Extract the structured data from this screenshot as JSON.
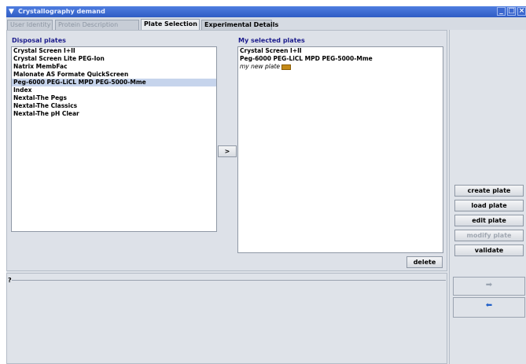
{
  "window": {
    "title": "Crystallography demand",
    "controls": {
      "minimize": "_",
      "maximize": "□",
      "close": "×"
    }
  },
  "tabs": [
    {
      "label": "User Identity",
      "state": "disabled"
    },
    {
      "label": "Protein Description",
      "state": "disabled"
    },
    {
      "label": "Plate Selection",
      "state": "active"
    },
    {
      "label": "Experimental Details",
      "state": "enabled"
    }
  ],
  "disposal": {
    "label": "Disposal plates",
    "items": [
      "Crystal Screen I+II",
      "Crystal Screen Lite PEG-Ion",
      "Natrix MembFac",
      "Malonate AS Formate QuickScreen",
      "Peg-6000 PEG-LiCL MPD PEG-5000-Mme",
      "Index",
      "Nextal-The Pegs",
      "Nextal-The Classics",
      "Nextal-The pH Clear"
    ],
    "selected_item": "Peg-6000 PEG-LiCL MPD PEG-5000-Mme"
  },
  "transfer_button": ">",
  "selected": {
    "label": "My selected plates",
    "items": [
      "Crystal Screen I+II",
      "Peg-6000 PEG-LiCL MPD PEG-5000-Mme",
      "my new plate"
    ]
  },
  "delete_button": "delete",
  "sidebar_buttons": {
    "create": "create plate",
    "load": "load plate",
    "edit": "edit plate",
    "modify": "modify plate",
    "validate": "validate"
  },
  "help": {
    "legend": "?"
  },
  "nav": {
    "forward_icon": "arrow-right-icon",
    "back_icon": "arrow-left-icon"
  },
  "colors": {
    "title_bar": "#3a66cc",
    "label": "#1a1a8c",
    "selected_row": "#c6d4ec",
    "badge": "#c48a17"
  }
}
